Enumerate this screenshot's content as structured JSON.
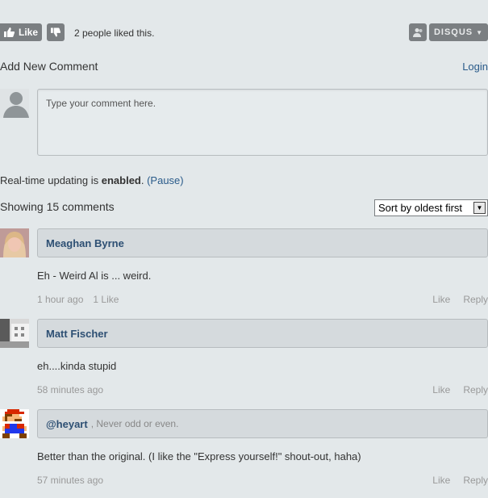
{
  "top": {
    "like_label": "Like",
    "likes_text": "2 people liked this.",
    "disqus_label": "DISQUS"
  },
  "compose": {
    "heading": "Add New Comment",
    "login": "Login",
    "placeholder": "Type your comment here."
  },
  "realtime": {
    "prefix": "Real-time updating is ",
    "state": "enabled",
    "suffix": ". ",
    "pause": "(Pause)"
  },
  "listing": {
    "showing": "Showing 15 comments",
    "sort": "Sort by oldest first"
  },
  "comments": [
    {
      "author": "Meaghan Byrne",
      "bio": "",
      "text": "Eh - Weird Al is ... weird.",
      "time": "1 hour ago",
      "likes": "1 Like",
      "like_action": "Like",
      "reply_action": "Reply"
    },
    {
      "author": "Matt Fischer",
      "bio": "",
      "text": "eh....kinda stupid",
      "time": "58 minutes ago",
      "likes": "",
      "like_action": "Like",
      "reply_action": "Reply"
    },
    {
      "author": "@heyart",
      "bio": ", Never odd or even.",
      "text": "Better than the original. (I like the \"Express yourself!\" shout-out, haha)",
      "time": "57 minutes ago",
      "likes": "",
      "like_action": "Like",
      "reply_action": "Reply"
    }
  ],
  "colors": {
    "background": "#e3e8ea",
    "link": "#2a5b8a",
    "author": "#2d4f73",
    "button": "#7b7f82"
  }
}
